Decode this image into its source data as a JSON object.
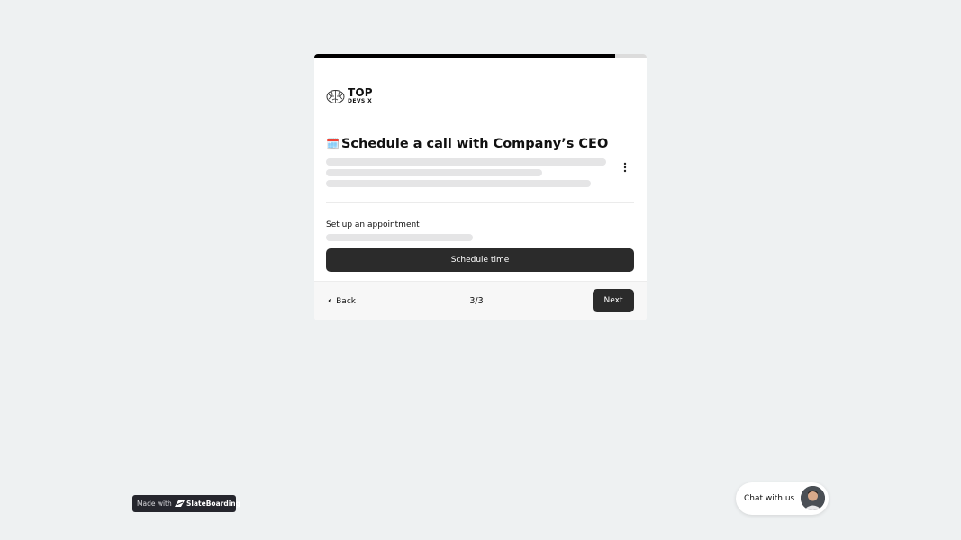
{
  "progress": {
    "value": 0.905
  },
  "logo": {
    "top": "TOP",
    "sub": "DEVS X",
    "icon": "brain-icon"
  },
  "header": {
    "emoji": "🗓️",
    "title": "Schedule a call with Company’s CEO"
  },
  "menu": {
    "icon": "kebab-menu-icon"
  },
  "appointment": {
    "label": "Set up an appointment",
    "button_label": "Schedule time"
  },
  "footer": {
    "back_label": "Back",
    "back_icon": "chevron-left-icon",
    "step": "3/3",
    "next_label": "Next"
  },
  "badge": {
    "prefix": "Made with",
    "brand": "SlateBoarding"
  },
  "chat": {
    "label": "Chat with us",
    "avatar": "avatar-icon"
  },
  "colors": {
    "background": "#eef1f2",
    "button": "#2b2b2b",
    "skeleton": "#e5e5e6",
    "badge": "#25262d"
  }
}
